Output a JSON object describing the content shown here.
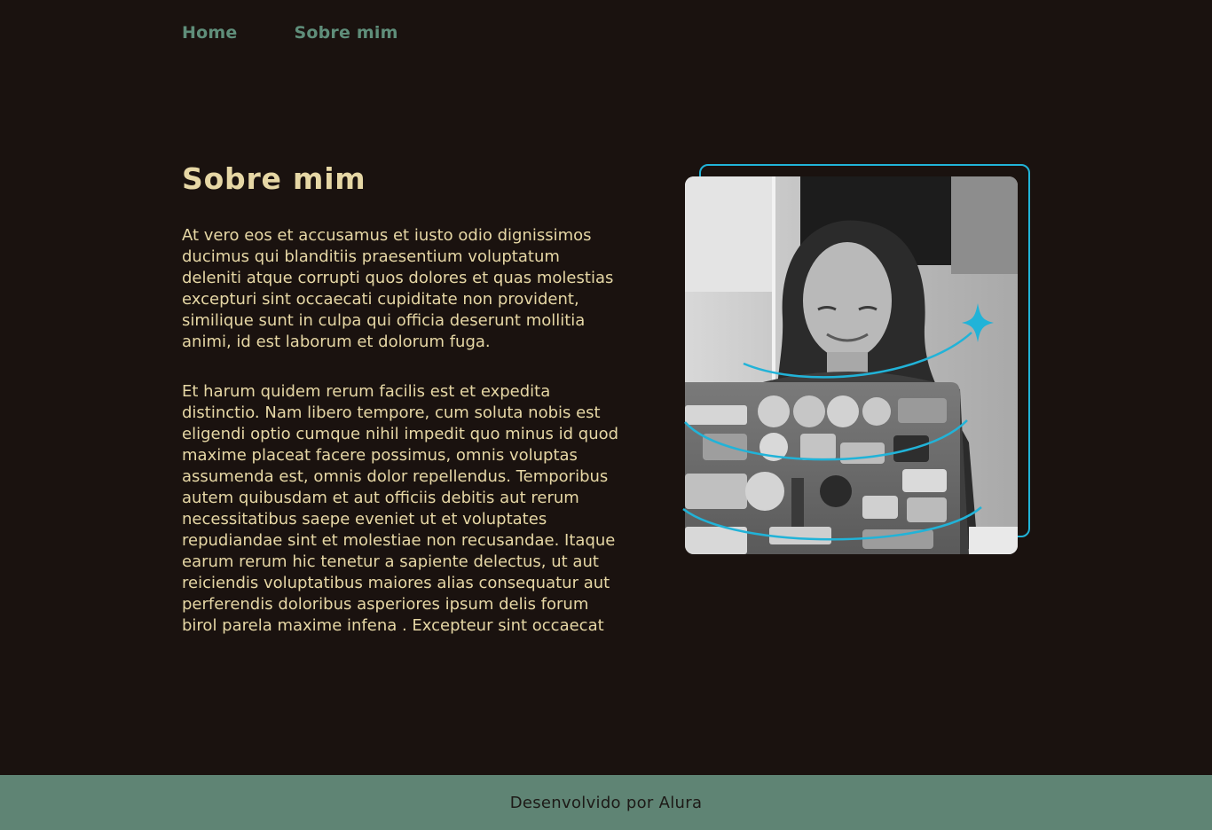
{
  "nav": {
    "items": [
      {
        "label": "Home"
      },
      {
        "label": "Sobre mim"
      }
    ]
  },
  "main": {
    "title": "Sobre mim",
    "paragraphs": [
      "At vero eos et accusamus et iusto odio dignissimos ducimus qui blanditiis praesentium voluptatum deleniti atque corrupti quos dolores et quas molestias excepturi sint occaecati cupiditate non provident, similique sunt in culpa qui officia deserunt mollitia animi, id est laborum et dolorum fuga.",
      "Et harum quidem rerum facilis est et expedita distinctio. Nam libero tempore, cum soluta nobis est eligendi optio cumque nihil impedit quo minus id quod maxime placeat facere possimus, omnis voluptas assumenda est, omnis dolor repellendus. Temporibus autem quibusdam et aut officiis debitis aut rerum necessitatibus saepe eveniet ut et voluptates repudiandae sint et molestiae non recusandae. Itaque earum rerum hic tenetur a sapiente delectus, ut aut reiciendis voluptatibus maiores alias consequatur aut perferendis doloribus asperiores ipsum delis forum birol parela maxime infena . Excepteur sint occaecat"
    ]
  },
  "footer": {
    "text": "Desenvolvido por Alura"
  },
  "colors": {
    "background": "#1a120f",
    "nav_text": "#5f8e7a",
    "heading": "#e6d7a5",
    "accent_cyan": "#21b3d8",
    "footer_bg": "#5f8474"
  }
}
